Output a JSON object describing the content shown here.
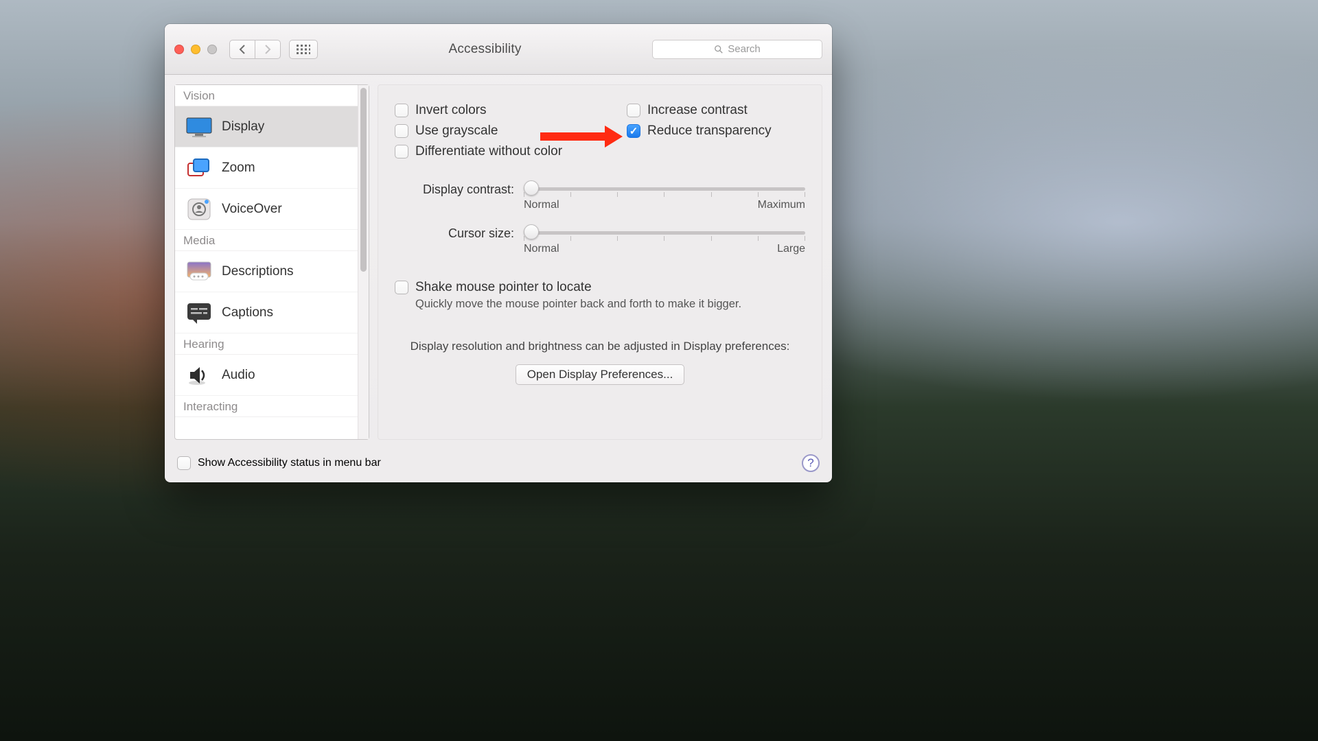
{
  "window": {
    "title": "Accessibility"
  },
  "search": {
    "placeholder": "Search"
  },
  "sidebar": {
    "sections": [
      {
        "title": "Vision",
        "items": [
          "Display",
          "Zoom",
          "VoiceOver"
        ]
      },
      {
        "title": "Media",
        "items": [
          "Descriptions",
          "Captions"
        ]
      },
      {
        "title": "Hearing",
        "items": [
          "Audio"
        ]
      },
      {
        "title": "Interacting",
        "items": []
      }
    ],
    "selected": "Display"
  },
  "checks": {
    "invert_colors": {
      "label": "Invert colors",
      "checked": false
    },
    "use_grayscale": {
      "label": "Use grayscale",
      "checked": false
    },
    "diff_without_color": {
      "label": "Differentiate without color",
      "checked": false
    },
    "increase_contrast": {
      "label": "Increase contrast",
      "checked": false
    },
    "reduce_transparency": {
      "label": "Reduce transparency",
      "checked": true
    }
  },
  "sliders": {
    "display_contrast": {
      "label": "Display contrast:",
      "min_label": "Normal",
      "max_label": "Maximum",
      "value": 0
    },
    "cursor_size": {
      "label": "Cursor size:",
      "min_label": "Normal",
      "max_label": "Large",
      "value": 0
    }
  },
  "shake": {
    "label": "Shake mouse pointer to locate",
    "hint": "Quickly move the mouse pointer back and forth to make it bigger.",
    "checked": false
  },
  "display_note": "Display resolution and brightness can be adjusted in Display preferences:",
  "open_display_prefs": "Open Display Preferences...",
  "footer": {
    "show_status": {
      "label": "Show Accessibility status in menu bar",
      "checked": false
    }
  }
}
